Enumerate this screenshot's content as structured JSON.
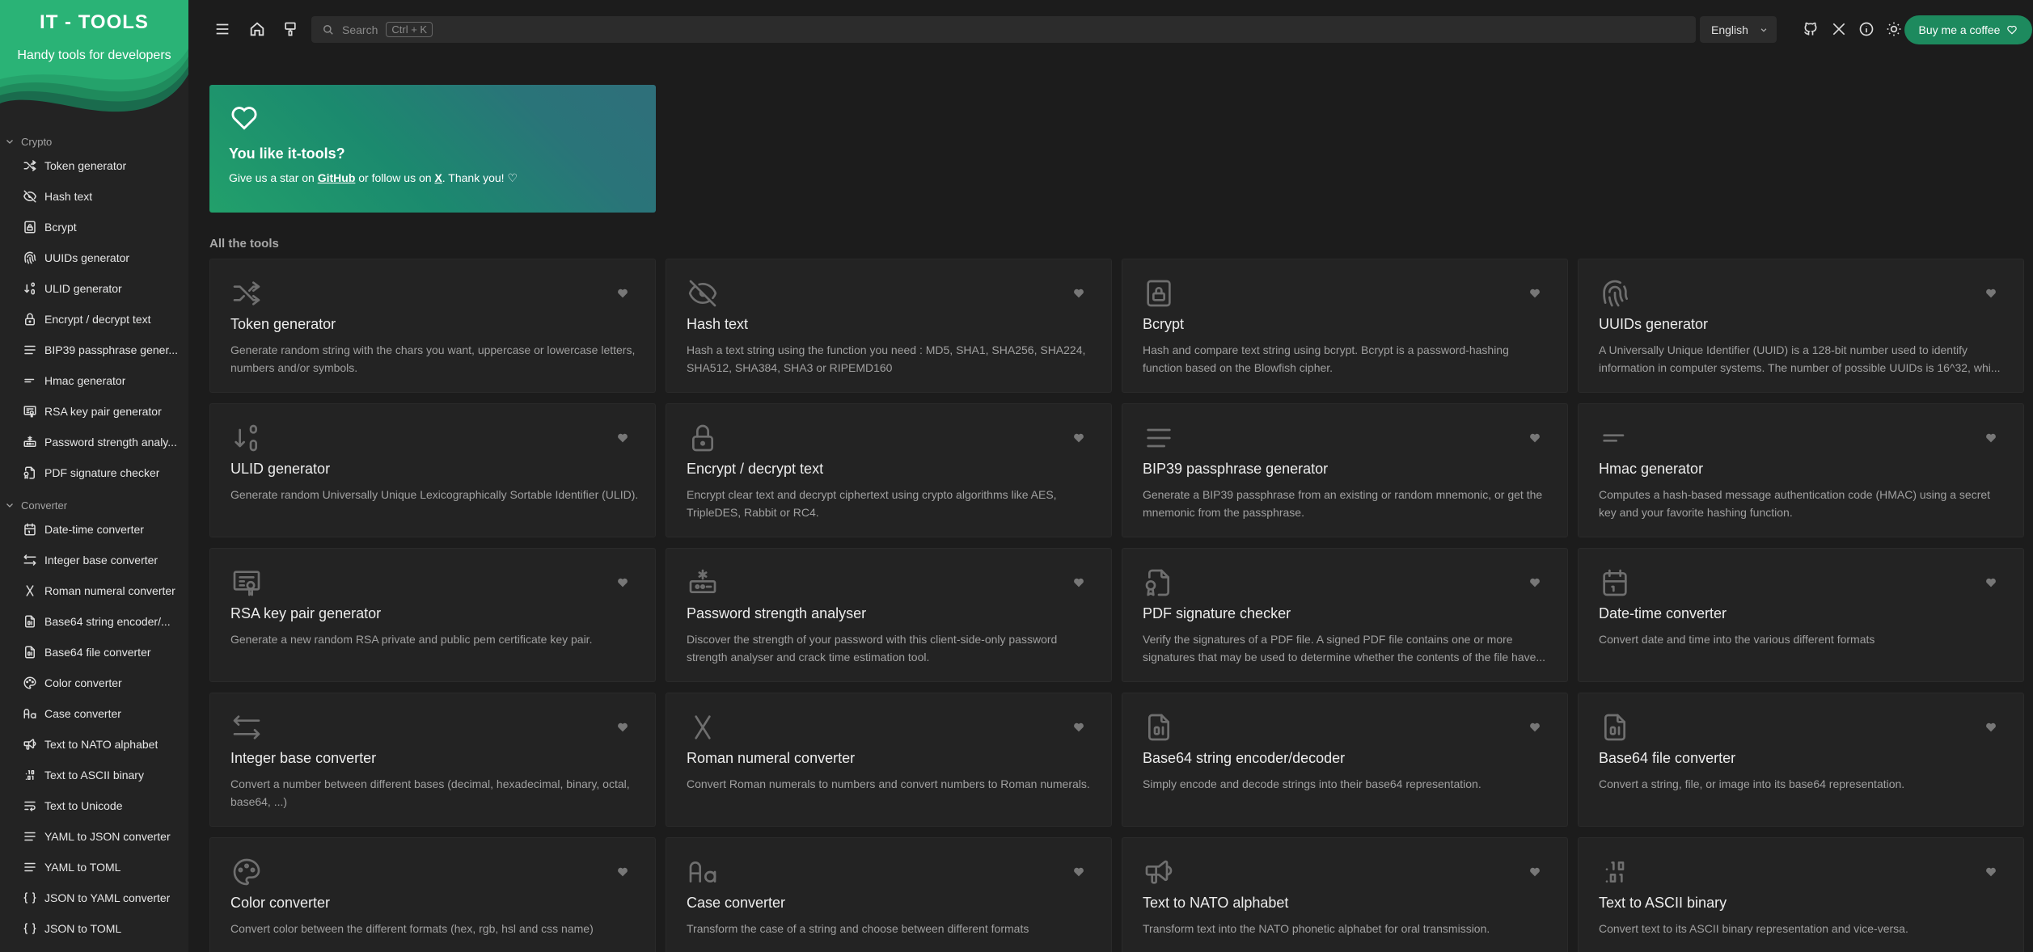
{
  "brand": {
    "title": "IT - TOOLS",
    "subtitle": "Handy tools for developers"
  },
  "sidebar": {
    "sections": [
      {
        "label": "Crypto",
        "items": [
          {
            "label": "Token generator",
            "icon": "shuffle-icon"
          },
          {
            "label": "Hash text",
            "icon": "eye-off-icon"
          },
          {
            "label": "Bcrypt",
            "icon": "lock-square-icon"
          },
          {
            "label": "UUIDs generator",
            "icon": "fingerprint-icon"
          },
          {
            "label": "ULID generator",
            "icon": "sort-numeric-icon"
          },
          {
            "label": "Encrypt / decrypt text",
            "icon": "lock-icon"
          },
          {
            "label": "BIP39 passphrase gener...",
            "icon": "align-justify-icon"
          },
          {
            "label": "Hmac generator",
            "icon": "short-text-icon"
          },
          {
            "label": "RSA key pair generator",
            "icon": "certificate-icon"
          },
          {
            "label": "Password strength analy...",
            "icon": "password-icon"
          },
          {
            "label": "PDF signature checker",
            "icon": "file-cert-icon"
          }
        ]
      },
      {
        "label": "Converter",
        "items": [
          {
            "label": "Date-time converter",
            "icon": "calendar-icon"
          },
          {
            "label": "Integer base converter",
            "icon": "arrows-left-right-icon"
          },
          {
            "label": "Roman numeral converter",
            "icon": "letter-x-icon"
          },
          {
            "label": "Base64 string encoder/...",
            "icon": "file-digit-icon"
          },
          {
            "label": "Base64 file converter",
            "icon": "file-digit-icon"
          },
          {
            "label": "Color converter",
            "icon": "palette-icon"
          },
          {
            "label": "Case converter",
            "icon": "letter-case-icon"
          },
          {
            "label": "Text to NATO alphabet",
            "icon": "speakerphone-icon"
          },
          {
            "label": "Text to ASCII binary",
            "icon": "binary-icon"
          },
          {
            "label": "Text to Unicode",
            "icon": "text-wrap-icon"
          },
          {
            "label": "YAML to JSON converter",
            "icon": "align-justify-icon"
          },
          {
            "label": "YAML to TOML",
            "icon": "align-justify-icon"
          },
          {
            "label": "JSON to YAML converter",
            "icon": "braces-icon"
          },
          {
            "label": "JSON to TOML",
            "icon": "braces-icon"
          }
        ]
      }
    ]
  },
  "topbar": {
    "search_placeholder": "Search",
    "search_shortcut": "Ctrl + K",
    "language": "English",
    "coffee_label": "Buy me a coffee"
  },
  "promo": {
    "title": "You like it-tools?",
    "text_before": "Give us a star on ",
    "github": "GitHub",
    "text_middle": " or follow us on ",
    "x": "X",
    "text_after": ". Thank you! ♡"
  },
  "all_tools_label": "All the tools",
  "cards": [
    {
      "title": "Token generator",
      "desc": "Generate random string with the chars you want, uppercase or lowercase letters, numbers and/or symbols.",
      "icon": "shuffle-icon"
    },
    {
      "title": "Hash text",
      "desc": "Hash a text string using the function you need : MD5, SHA1, SHA256, SHA224, SHA512, SHA384, SHA3 or RIPEMD160",
      "icon": "eye-off-icon"
    },
    {
      "title": "Bcrypt",
      "desc": "Hash and compare text string using bcrypt. Bcrypt is a password-hashing function based on the Blowfish cipher.",
      "icon": "lock-square-icon"
    },
    {
      "title": "UUIDs generator",
      "desc": "A Universally Unique Identifier (UUID) is a 128-bit number used to identify information in computer systems. The number of possible UUIDs is 16^32, whi...",
      "icon": "fingerprint-icon"
    },
    {
      "title": "ULID generator",
      "desc": "Generate random Universally Unique Lexicographically Sortable Identifier (ULID).",
      "icon": "sort-numeric-icon"
    },
    {
      "title": "Encrypt / decrypt text",
      "desc": "Encrypt clear text and decrypt ciphertext using crypto algorithms like AES, TripleDES, Rabbit or RC4.",
      "icon": "lock-icon"
    },
    {
      "title": "BIP39 passphrase generator",
      "desc": "Generate a BIP39 passphrase from an existing or random mnemonic, or get the mnemonic from the passphrase.",
      "icon": "align-justify-icon"
    },
    {
      "title": "Hmac generator",
      "desc": "Computes a hash-based message authentication code (HMAC) using a secret key and your favorite hashing function.",
      "icon": "short-text-icon"
    },
    {
      "title": "RSA key pair generator",
      "desc": "Generate a new random RSA private and public pem certificate key pair.",
      "icon": "certificate-icon"
    },
    {
      "title": "Password strength analyser",
      "desc": "Discover the strength of your password with this client-side-only password strength analyser and crack time estimation tool.",
      "icon": "password-icon"
    },
    {
      "title": "PDF signature checker",
      "desc": "Verify the signatures of a PDF file. A signed PDF file contains one or more signatures that may be used to determine whether the contents of the file have...",
      "icon": "file-cert-icon"
    },
    {
      "title": "Date-time converter",
      "desc": "Convert date and time into the various different formats",
      "icon": "calendar-icon"
    },
    {
      "title": "Integer base converter",
      "desc": "Convert a number between different bases (decimal, hexadecimal, binary, octal, base64, ...)",
      "icon": "arrows-left-right-icon"
    },
    {
      "title": "Roman numeral converter",
      "desc": "Convert Roman numerals to numbers and convert numbers to Roman numerals.",
      "icon": "letter-x-icon"
    },
    {
      "title": "Base64 string encoder/decoder",
      "desc": "Simply encode and decode strings into their base64 representation.",
      "icon": "file-digit-icon"
    },
    {
      "title": "Base64 file converter",
      "desc": "Convert a string, file, or image into its base64 representation.",
      "icon": "file-digit-icon"
    },
    {
      "title": "Color converter",
      "desc": "Convert color between the different formats (hex, rgb, hsl and css name)",
      "icon": "palette-icon"
    },
    {
      "title": "Case converter",
      "desc": "Transform the case of a string and choose between different formats",
      "icon": "letter-case-icon"
    },
    {
      "title": "Text to NATO alphabet",
      "desc": "Transform text into the NATO phonetic alphabet for oral transmission.",
      "icon": "speakerphone-icon"
    },
    {
      "title": "Text to ASCII binary",
      "desc": "Convert text to its ASCII binary representation and vice-versa.",
      "icon": "binary-icon"
    }
  ],
  "colors": {
    "accent": "#1d8a5e",
    "background": "#1c1c1c",
    "card": "#232323",
    "sidebar": "#232323"
  }
}
